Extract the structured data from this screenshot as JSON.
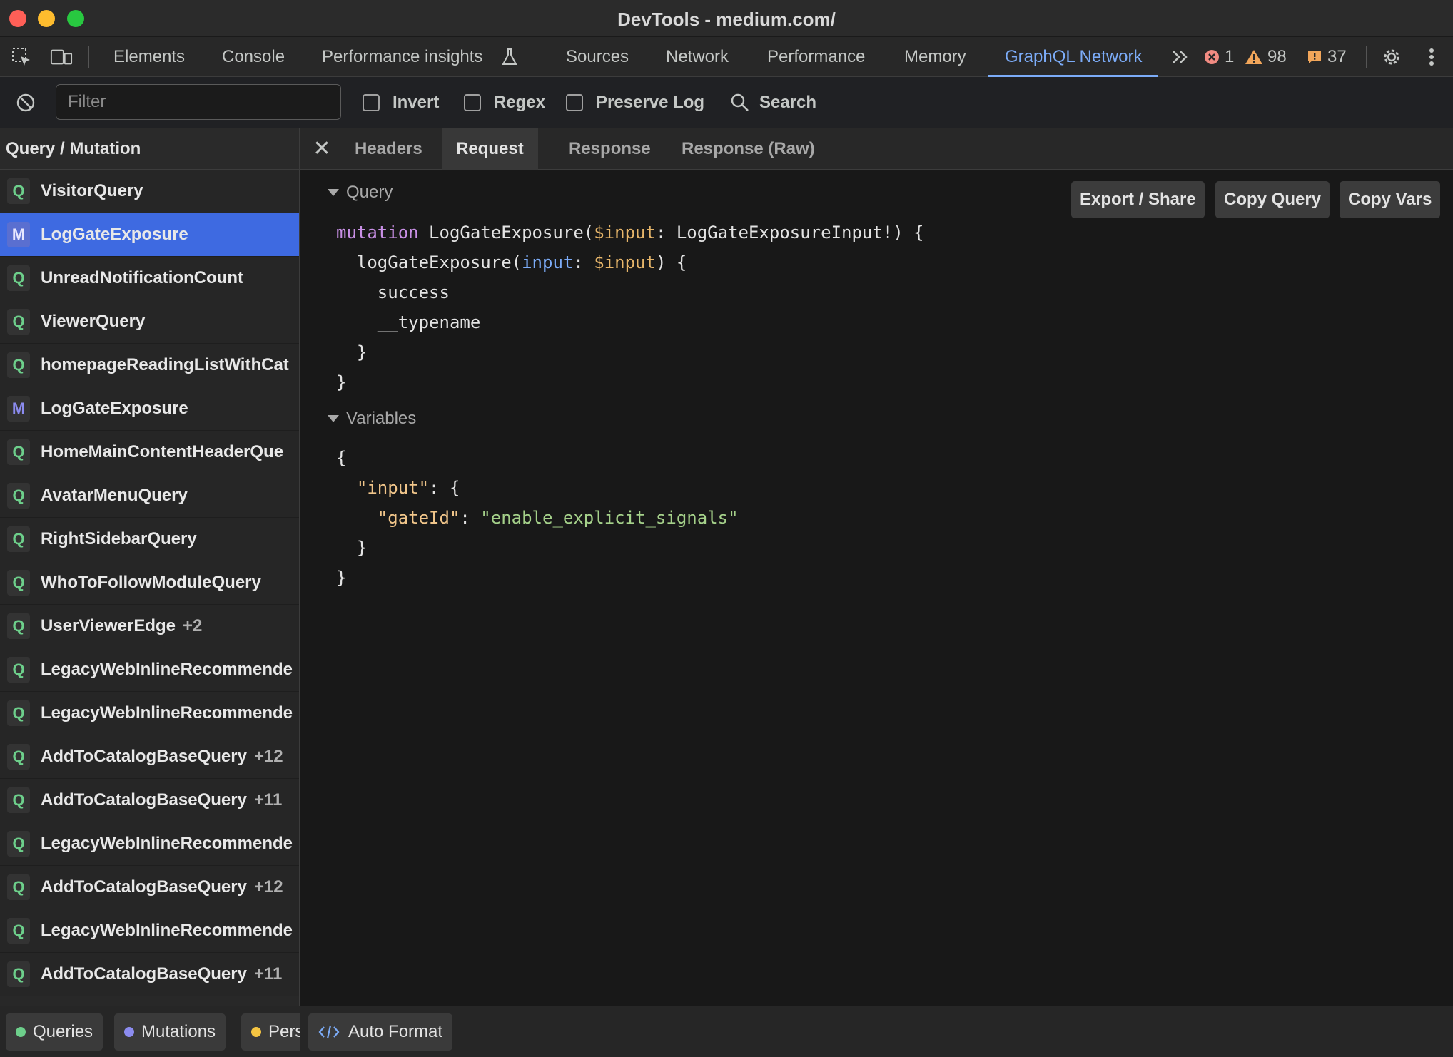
{
  "window": {
    "title": "DevTools - medium.com/"
  },
  "toolbar": {
    "tabs": [
      "Elements",
      "Console",
      "Performance insights",
      "Sources",
      "Network",
      "Performance",
      "Memory",
      "GraphQL Network"
    ],
    "active_tab": "GraphQL Network",
    "errors": "1",
    "warnings": "98",
    "issues": "37"
  },
  "filter": {
    "placeholder": "Filter",
    "value": "",
    "invert_label": "Invert",
    "regex_label": "Regex",
    "preserve_log_label": "Preserve Log",
    "search_label": "Search"
  },
  "sidebar": {
    "header": "Query / Mutation",
    "items": [
      {
        "type": "Q",
        "label": "VisitorQuery",
        "count": ""
      },
      {
        "type": "M",
        "label": "LogGateExposure",
        "count": "",
        "selected": true
      },
      {
        "type": "Q",
        "label": "UnreadNotificationCount",
        "count": ""
      },
      {
        "type": "Q",
        "label": "ViewerQuery",
        "count": ""
      },
      {
        "type": "Q",
        "label": "homepageReadingListWithCat",
        "count": ""
      },
      {
        "type": "M",
        "label": "LogGateExposure",
        "count": ""
      },
      {
        "type": "Q",
        "label": "HomeMainContentHeaderQue",
        "count": ""
      },
      {
        "type": "Q",
        "label": "AvatarMenuQuery",
        "count": ""
      },
      {
        "type": "Q",
        "label": "RightSidebarQuery",
        "count": ""
      },
      {
        "type": "Q",
        "label": "WhoToFollowModuleQuery",
        "count": ""
      },
      {
        "type": "Q",
        "label": "UserViewerEdge",
        "count": "+2"
      },
      {
        "type": "Q",
        "label": "LegacyWebInlineRecommende",
        "count": ""
      },
      {
        "type": "Q",
        "label": "LegacyWebInlineRecommende",
        "count": ""
      },
      {
        "type": "Q",
        "label": "AddToCatalogBaseQuery",
        "count": "+12"
      },
      {
        "type": "Q",
        "label": "AddToCatalogBaseQuery",
        "count": "+11"
      },
      {
        "type": "Q",
        "label": "LegacyWebInlineRecommende",
        "count": ""
      },
      {
        "type": "Q",
        "label": "AddToCatalogBaseQuery",
        "count": "+12"
      },
      {
        "type": "Q",
        "label": "LegacyWebInlineRecommende",
        "count": ""
      },
      {
        "type": "Q",
        "label": "AddToCatalogBaseQuery",
        "count": "+11"
      }
    ]
  },
  "legend": {
    "queries": "Queries",
    "mutations": "Mutations",
    "persisted": "Pers",
    "colors": {
      "queries": "#6dcf8b",
      "mutations": "#8c8cf0",
      "persisted": "#f5c542"
    }
  },
  "auto_format_label": "Auto Format",
  "detail": {
    "tabs": [
      "Headers",
      "Request",
      "Response",
      "Response (Raw)"
    ],
    "active_tab": "Request",
    "query_section": "Query",
    "variables_section": "Variables",
    "buttons": {
      "export": "Export / Share",
      "copy_query": "Copy Query",
      "copy_vars": "Copy Vars"
    },
    "query_code": {
      "l1_kw": "mutation",
      "l1_name": " LogGateExposure(",
      "l1_var": "$input",
      "l1_rest": ": LogGateExposureInput!) {",
      "l2_name": "  logGateExposure(",
      "l2_arg": "input",
      "l2_colon": ": ",
      "l2_var": "$input",
      "l2_rest": ") {",
      "l3": "    success",
      "l4": "    __typename",
      "l5": "  }",
      "l6": "}"
    },
    "variables_code": {
      "l1": "{",
      "l2_key": "  \"input\"",
      "l2_rest": ": {",
      "l3_key": "    \"gateId\"",
      "l3_colon": ": ",
      "l3_val": "\"enable_explicit_signals\"",
      "l4": "  }",
      "l5": "}"
    }
  },
  "colors": {
    "accent": "#7cacf8",
    "selected_row": "#3e6ae1"
  }
}
